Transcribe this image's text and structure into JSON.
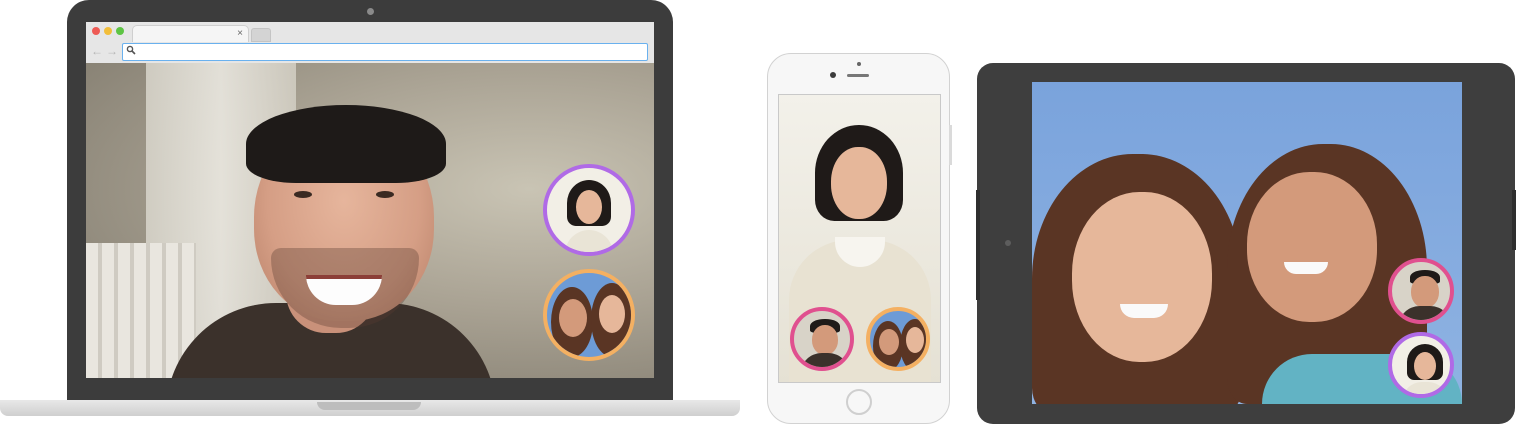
{
  "laptop": {
    "browser": {
      "tab_close": "×",
      "nav_back": "←",
      "nav_forward": "→",
      "address_value": "",
      "icons": [
        "search-icon"
      ]
    },
    "main_video": "man-smiling",
    "participants": [
      {
        "id": "woman-short-hair",
        "ring_color": "#b06ae6"
      },
      {
        "id": "two-girls",
        "ring_color": "#f4b062"
      }
    ]
  },
  "phone": {
    "main_video": "woman-short-hair",
    "participants": [
      {
        "id": "man-smiling",
        "ring_color": "#e0508f"
      },
      {
        "id": "two-girls",
        "ring_color": "#f4b062"
      }
    ]
  },
  "tablet": {
    "main_video": "two-girls",
    "participants": [
      {
        "id": "man-smiling",
        "ring_color": "#e0508f"
      },
      {
        "id": "woman-short-hair",
        "ring_color": "#b06ae6"
      }
    ]
  },
  "colors": {
    "ring_purple": "#b06ae6",
    "ring_orange": "#f4b062",
    "ring_pink": "#e0508f",
    "device_dark": "#3c3c3c",
    "sky_blue": "#7fa7dc"
  }
}
